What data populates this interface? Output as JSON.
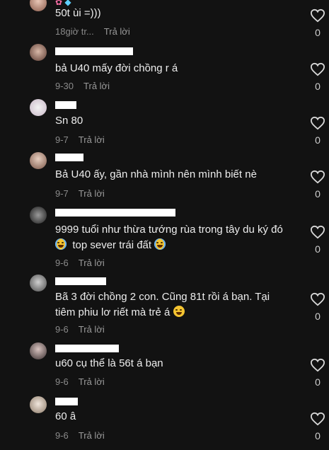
{
  "reply_label": "Trả lời",
  "comments": [
    {
      "text_lines": [
        "50t ùi =)))"
      ],
      "time": "18giờ tr...",
      "likes": "0"
    },
    {
      "text_lines": [
        "bả U40 mấy đời chồng r á"
      ],
      "time": "9-30",
      "likes": "0"
    },
    {
      "text_lines": [
        "Sn 80"
      ],
      "time": "9-7",
      "likes": "0"
    },
    {
      "text_lines": [
        "Bả U40 ấy, gần nhà mình nên mình biết nè"
      ],
      "time": "9-7",
      "likes": "0"
    },
    {
      "text_lines": [
        "9999 tuổi như thừa tướng rùa trong tây du ký đó",
        "top sever trái đất"
      ],
      "time": "9-6",
      "likes": "0"
    },
    {
      "text_lines": [
        "Bã 3 đời chồng 2 con. Cũng 81t rồi á bạn. Tại",
        "tiêm phiu lơ riết mà trẻ á"
      ],
      "time": "9-6",
      "likes": "0"
    },
    {
      "text_lines": [
        "u60 cụ thể là 56t á bạn"
      ],
      "time": "9-6",
      "likes": "0"
    },
    {
      "text_lines": [
        "60 â"
      ],
      "time": "9-6",
      "likes": "0"
    }
  ],
  "icons": {
    "like": "heart-outline-icon",
    "tears_emoji": "face-with-tears-of-joy-icon",
    "laugh_emoji": "rolling-laughing-icon"
  },
  "colors": {
    "background": "#121212",
    "text": "#ededed",
    "meta": "#8a8a8a"
  }
}
